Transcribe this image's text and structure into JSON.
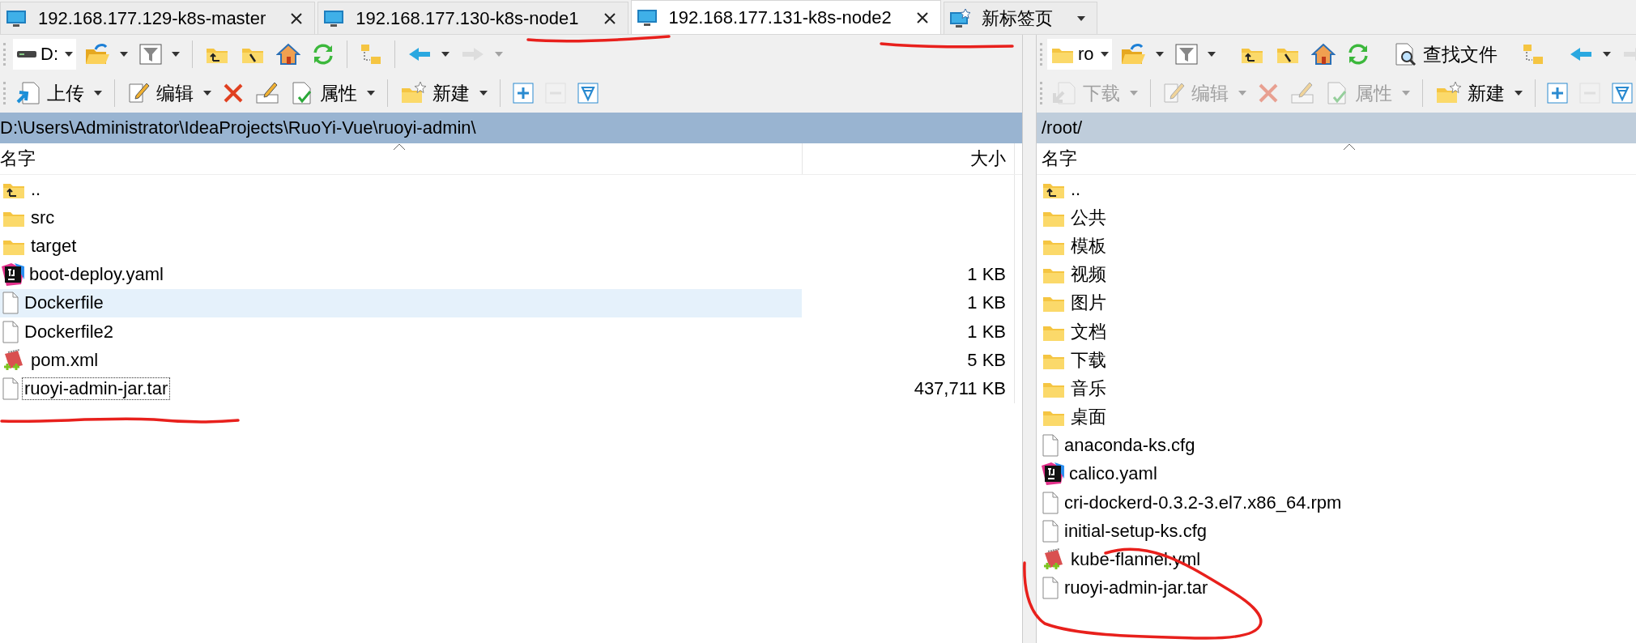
{
  "tabs": [
    {
      "label": "192.168.177.129-k8s-master",
      "kind": "session",
      "selected": false
    },
    {
      "label": "192.168.177.130-k8s-node1",
      "kind": "session",
      "selected": false
    },
    {
      "label": "192.168.177.131-k8s-node2",
      "kind": "session",
      "selected": true
    },
    {
      "label": "新标签页",
      "kind": "new",
      "selected": false
    }
  ],
  "left_pane": {
    "toolbar_1": [
      {
        "kind": "drive",
        "label": "D:",
        "dropdown": true,
        "disabled": false
      },
      {
        "kind": "open",
        "dropdown": true,
        "disabled": false
      },
      {
        "kind": "filter",
        "dropdown": true,
        "disabled": false
      },
      {
        "kind": "sep"
      },
      {
        "kind": "parent",
        "dropdown": false,
        "disabled": false
      },
      {
        "kind": "root",
        "dropdown": false,
        "disabled": false
      },
      {
        "kind": "home",
        "dropdown": false,
        "disabled": false
      },
      {
        "kind": "refresh",
        "dropdown": false,
        "disabled": false
      },
      {
        "kind": "sep"
      },
      {
        "kind": "tree",
        "dropdown": false,
        "disabled": false
      },
      {
        "kind": "sep"
      },
      {
        "kind": "back",
        "dropdown": true,
        "disabled": false
      },
      {
        "kind": "forward",
        "dropdown": true,
        "disabled": true
      }
    ],
    "toolbar_2": [
      {
        "kind": "upload",
        "label": "上传",
        "dropdown": true,
        "disabled": false
      },
      {
        "kind": "sep"
      },
      {
        "kind": "edit",
        "label": "编辑",
        "dropdown": true,
        "disabled": false
      },
      {
        "kind": "delete",
        "dropdown": false,
        "disabled": false
      },
      {
        "kind": "rename",
        "dropdown": false,
        "disabled": false
      },
      {
        "kind": "properties",
        "label": "属性",
        "dropdown": true,
        "disabled": false
      },
      {
        "kind": "sep"
      },
      {
        "kind": "new",
        "label": "新建",
        "dropdown": true,
        "disabled": false
      },
      {
        "kind": "sep"
      },
      {
        "kind": "plus",
        "dropdown": false,
        "disabled": false
      },
      {
        "kind": "minus",
        "dropdown": false,
        "disabled": true
      },
      {
        "kind": "select",
        "dropdown": false,
        "disabled": false
      }
    ],
    "path": "D:\\Users\\Administrator\\IdeaProjects\\RuoYi-Vue\\ruoyi-admin\\",
    "columns": [
      "名字",
      "大小"
    ],
    "rows": [
      {
        "kind": "parent",
        "name": "..",
        "highlighted": false,
        "focused": false
      },
      {
        "kind": "folder",
        "name": "src",
        "highlighted": false,
        "focused": false
      },
      {
        "kind": "folder",
        "name": "target",
        "highlighted": false,
        "focused": false
      },
      {
        "kind": "ide",
        "name": "boot-deploy.yaml",
        "size": "1 KB",
        "highlighted": false,
        "focused": false
      },
      {
        "kind": "file",
        "name": "Dockerfile",
        "size": "1 KB",
        "highlighted": true,
        "focused": false
      },
      {
        "kind": "file",
        "name": "Dockerfile2",
        "size": "1 KB",
        "highlighted": false,
        "focused": false
      },
      {
        "kind": "notepad",
        "name": "pom.xml",
        "size": "5 KB",
        "highlighted": false,
        "focused": false
      },
      {
        "kind": "file",
        "name": "ruoyi-admin-jar.tar",
        "size": "437,711 KB",
        "highlighted": false,
        "focused": true
      }
    ]
  },
  "right_pane": {
    "toolbar_1": [
      {
        "kind": "dir",
        "label": "ro",
        "dropdown": true,
        "disabled": false
      },
      {
        "kind": "open",
        "dropdown": true,
        "disabled": false
      },
      {
        "kind": "filter",
        "dropdown": true,
        "disabled": false
      },
      {
        "kind": "sep"
      },
      {
        "kind": "parent",
        "dropdown": false,
        "disabled": false
      },
      {
        "kind": "root",
        "dropdown": false,
        "disabled": false
      },
      {
        "kind": "home",
        "dropdown": false,
        "disabled": false
      },
      {
        "kind": "refresh",
        "dropdown": false,
        "disabled": false
      },
      {
        "kind": "sep"
      },
      {
        "kind": "find",
        "label": "查找文件",
        "dropdown": false,
        "disabled": false
      },
      {
        "kind": "sep"
      },
      {
        "kind": "tree",
        "dropdown": false,
        "disabled": false
      },
      {
        "kind": "sep"
      },
      {
        "kind": "back",
        "dropdown": true,
        "disabled": false
      },
      {
        "kind": "forward",
        "dropdown": false,
        "disabled": true
      }
    ],
    "toolbar_2": [
      {
        "kind": "download",
        "label": "下载",
        "dropdown": true,
        "disabled": true
      },
      {
        "kind": "sep"
      },
      {
        "kind": "edit",
        "label": "编辑",
        "dropdown": true,
        "disabled": true
      },
      {
        "kind": "delete",
        "dropdown": false,
        "disabled": true
      },
      {
        "kind": "rename",
        "dropdown": false,
        "disabled": true
      },
      {
        "kind": "properties",
        "label": "属性",
        "dropdown": true,
        "disabled": true
      },
      {
        "kind": "sep"
      },
      {
        "kind": "new",
        "label": "新建",
        "dropdown": true,
        "disabled": false
      },
      {
        "kind": "sep"
      },
      {
        "kind": "plus",
        "dropdown": false,
        "disabled": false
      },
      {
        "kind": "minus",
        "dropdown": false,
        "disabled": true
      },
      {
        "kind": "select",
        "dropdown": false,
        "disabled": false
      }
    ],
    "path": "/root/",
    "columns": [
      "名字"
    ],
    "rows": [
      {
        "kind": "parent",
        "name": "..",
        "highlighted": false,
        "focused": false
      },
      {
        "kind": "folder",
        "name": "公共",
        "highlighted": false,
        "focused": false
      },
      {
        "kind": "folder",
        "name": "模板",
        "highlighted": false,
        "focused": false
      },
      {
        "kind": "folder",
        "name": "视频",
        "highlighted": false,
        "focused": false
      },
      {
        "kind": "folder",
        "name": "图片",
        "highlighted": false,
        "focused": false
      },
      {
        "kind": "folder",
        "name": "文档",
        "highlighted": false,
        "focused": false
      },
      {
        "kind": "folder",
        "name": "下载",
        "highlighted": false,
        "focused": false
      },
      {
        "kind": "folder",
        "name": "音乐",
        "highlighted": false,
        "focused": false
      },
      {
        "kind": "folder",
        "name": "桌面",
        "highlighted": false,
        "focused": false
      },
      {
        "kind": "file",
        "name": "anaconda-ks.cfg",
        "highlighted": false,
        "focused": false
      },
      {
        "kind": "ide",
        "name": "calico.yaml",
        "highlighted": false,
        "focused": false
      },
      {
        "kind": "file",
        "name": "cri-dockerd-0.3.2-3.el7.x86_64.rpm",
        "highlighted": false,
        "focused": false
      },
      {
        "kind": "file",
        "name": "initial-setup-ks.cfg",
        "highlighted": false,
        "focused": false
      },
      {
        "kind": "notepad",
        "name": "kube-flannel.yml",
        "highlighted": false,
        "focused": false
      },
      {
        "kind": "file",
        "name": "ruoyi-admin-jar.tar",
        "highlighted": false,
        "focused": false
      }
    ]
  }
}
